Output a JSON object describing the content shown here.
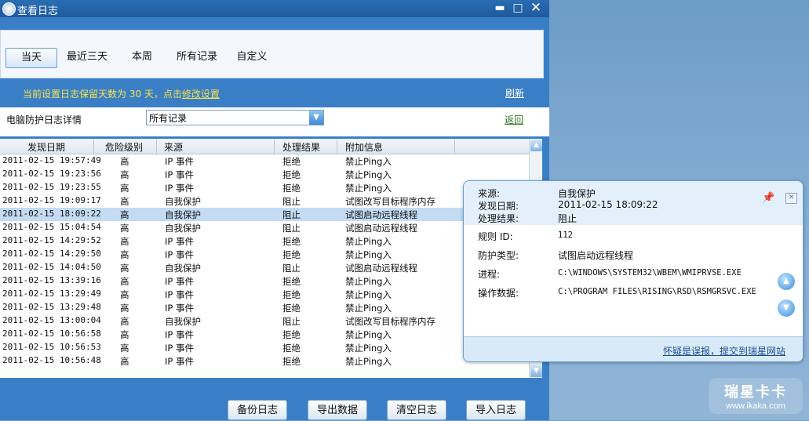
{
  "window": {
    "title": "查看日志"
  },
  "filters": {
    "tabs": [
      "当天",
      "最近三天",
      "本周",
      "所有记录",
      "自定义"
    ],
    "active": "当天"
  },
  "info_bar": {
    "retention_prefix": "当前设置日志保留天数为 30 天，点击",
    "modify_link": "修改设置",
    "refresh": "刷新"
  },
  "detail_header": {
    "label": "电脑防护日志详情",
    "select_value": "所有记录",
    "back": "返回"
  },
  "table": {
    "columns": [
      "发现日期",
      "危险级别",
      "来源",
      "处理结果",
      "附加信息"
    ],
    "rows": [
      [
        "2011-02-15 19:57:49",
        "高",
        "IP 事件",
        "拒绝",
        "禁止Ping入"
      ],
      [
        "2011-02-15 19:23:56",
        "高",
        "IP 事件",
        "拒绝",
        "禁止Ping入"
      ],
      [
        "2011-02-15 19:23:55",
        "高",
        "IP 事件",
        "拒绝",
        "禁止Ping入"
      ],
      [
        "2011-02-15 19:09:17",
        "高",
        "自我保护",
        "阻止",
        "试图改写目标程序内存"
      ],
      [
        "2011-02-15 18:09:22",
        "高",
        "自我保护",
        "阻止",
        "试图启动远程线程"
      ],
      [
        "2011-02-15 15:04:54",
        "高",
        "自我保护",
        "阻止",
        "试图启动远程线程"
      ],
      [
        "2011-02-15 14:29:52",
        "高",
        "IP 事件",
        "拒绝",
        "禁止Ping入"
      ],
      [
        "2011-02-15 14:29:50",
        "高",
        "IP 事件",
        "拒绝",
        "禁止Ping入"
      ],
      [
        "2011-02-15 14:04:50",
        "高",
        "自我保护",
        "阻止",
        "试图启动远程线程"
      ],
      [
        "2011-02-15 13:39:16",
        "高",
        "IP 事件",
        "拒绝",
        "禁止Ping入"
      ],
      [
        "2011-02-15 13:29:49",
        "高",
        "IP 事件",
        "拒绝",
        "禁止Ping入"
      ],
      [
        "2011-02-15 13:29:48",
        "高",
        "IP 事件",
        "拒绝",
        "禁止Ping入"
      ],
      [
        "2011-02-15 13:00:04",
        "高",
        "自我保护",
        "阻止",
        "试图改写目标程序内存"
      ],
      [
        "2011-02-15 10:56:58",
        "高",
        "IP 事件",
        "拒绝",
        "禁止Ping入"
      ],
      [
        "2011-02-15 10:56:53",
        "高",
        "IP 事件",
        "拒绝",
        "禁止Ping入"
      ],
      [
        "2011-02-15 10:56:48",
        "高",
        "IP 事件",
        "拒绝",
        "禁止Ping入"
      ]
    ],
    "selected_index": 4
  },
  "actions": {
    "backup": "备份日志",
    "export": "导出数据",
    "clear": "清空日志",
    "import": "导入日志"
  },
  "popup": {
    "source_label": "来源:",
    "source_value": "自我保护",
    "date_label": "发现日期:",
    "date_value": "2011-02-15 18:09:22",
    "result_label": "处理结果:",
    "result_value": "阻止",
    "rule_label": "规则 ID:",
    "rule_value": "112",
    "type_label": "防护类型:",
    "type_value": "试图启动远程线程",
    "process_label": "进程:",
    "process_value": "C:\\WINDOWS\\SYSTEM32\\WBEM\\WMIPRVSE.EXE",
    "opdata_label": "操作数据:",
    "opdata_value": "C:\\PROGRAM FILES\\RISING\\RSD\\RSMGRSVC.EXE",
    "report_link": "怀疑是误报，提交到瑞星网站"
  },
  "watermark": {
    "title": "瑞星卡卡",
    "url": "www.ikaka.com"
  },
  "colors": {
    "titlebar": "#1e5a9c",
    "window_bg": "#3a7fc6",
    "info_text": "#f6e24a",
    "back_link": "#2a7b1e",
    "selected_row": "#c3dbf3"
  }
}
